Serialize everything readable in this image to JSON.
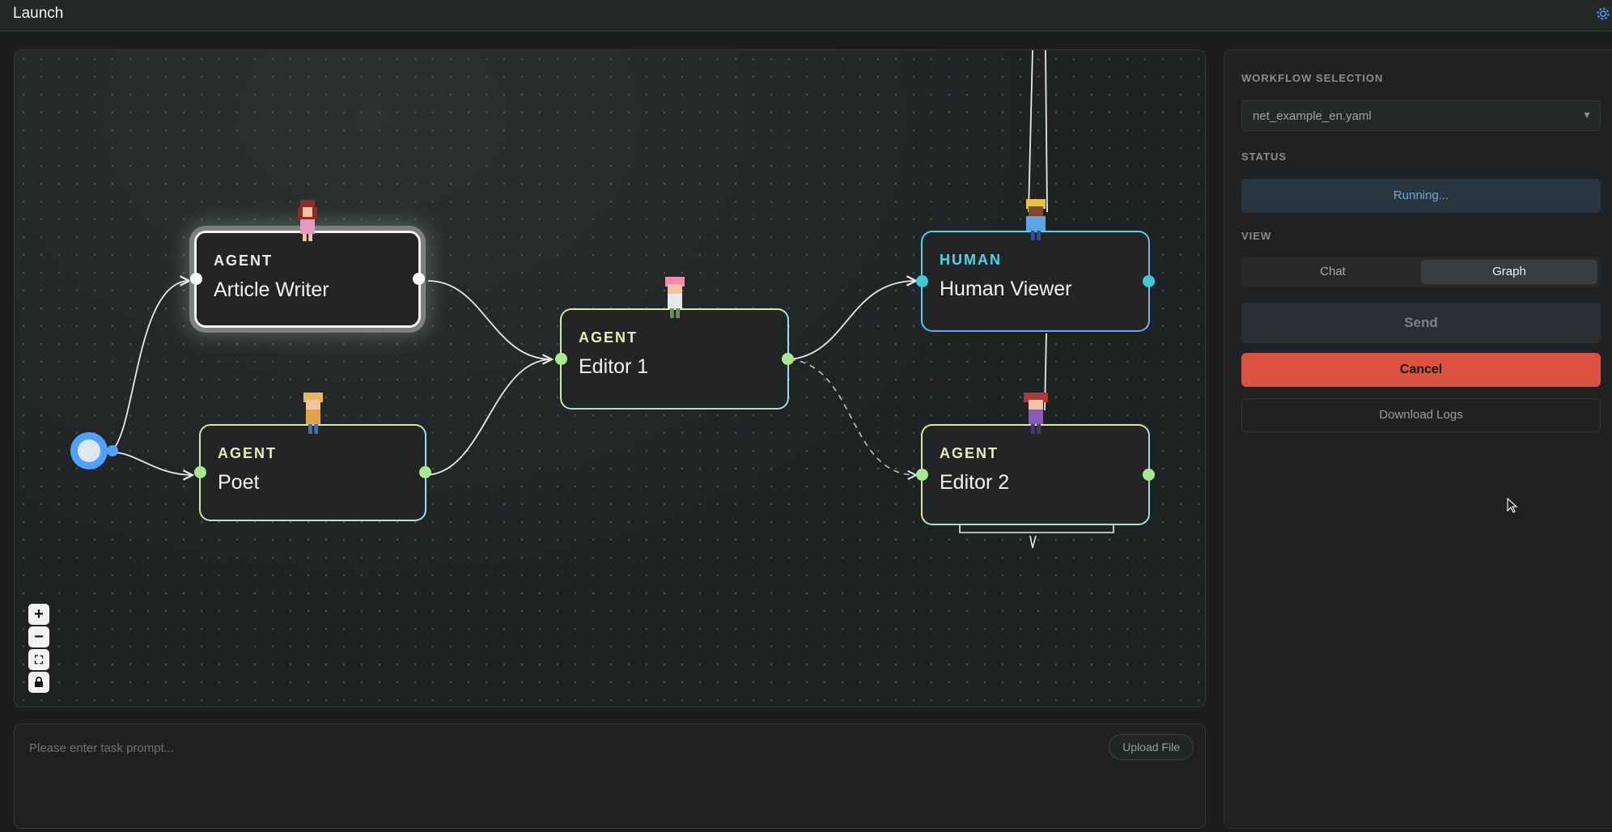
{
  "app": {
    "title": "Launch"
  },
  "colors": {
    "agent_label": "#e9efb5",
    "human_label": "#55d3e6",
    "handle_green": "#a8e890",
    "handle_cyan": "#40c8d8",
    "start_node": "#4da3ff",
    "cancel": "#db5340",
    "status_text": "#6ea6dd"
  },
  "graph": {
    "nodes": [
      {
        "id": "article-writer",
        "type": "AGENT",
        "name": "Article Writer",
        "state": "active",
        "avatar": "girl-red-hair-icon"
      },
      {
        "id": "poet",
        "type": "AGENT",
        "name": "Poet",
        "avatar": "boy-blond-hair-icon"
      },
      {
        "id": "editor-1",
        "type": "AGENT",
        "name": "Editor 1",
        "avatar": "pink-hair-character-icon"
      },
      {
        "id": "human-viewer",
        "type": "HUMAN",
        "name": "Human Viewer",
        "avatar": "crowned-character-icon"
      },
      {
        "id": "editor-2",
        "type": "AGENT",
        "name": "Editor 2",
        "avatar": "spiky-red-hair-character-icon"
      }
    ],
    "edges": [
      {
        "from": "start",
        "to": "article-writer",
        "style": "solid"
      },
      {
        "from": "start",
        "to": "poet",
        "style": "solid"
      },
      {
        "from": "article-writer",
        "to": "editor-1",
        "style": "solid"
      },
      {
        "from": "poet",
        "to": "editor-1",
        "style": "solid"
      },
      {
        "from": "editor-1",
        "to": "human-viewer",
        "style": "solid"
      },
      {
        "from": "editor-1",
        "to": "editor-2",
        "style": "dashed"
      },
      {
        "from": "editor-2",
        "to": "human-viewer",
        "style": "solid"
      }
    ]
  },
  "zoom_controls": {
    "zoom_in": "+",
    "zoom_out": "−",
    "fit": "⛶",
    "lock": "🔒"
  },
  "prompt": {
    "placeholder": "Please enter task prompt...",
    "upload_label": "Upload File"
  },
  "sidebar": {
    "workflow_label": "WORKFLOW SELECTION",
    "workflow_value": "net_example_en.yaml",
    "status_label": "STATUS",
    "status_value": "Running...",
    "view_label": "VIEW",
    "view_options": [
      "Chat",
      "Graph"
    ],
    "view_selected": "Graph",
    "send_label": "Send",
    "cancel_label": "Cancel",
    "download_label": "Download Logs"
  }
}
